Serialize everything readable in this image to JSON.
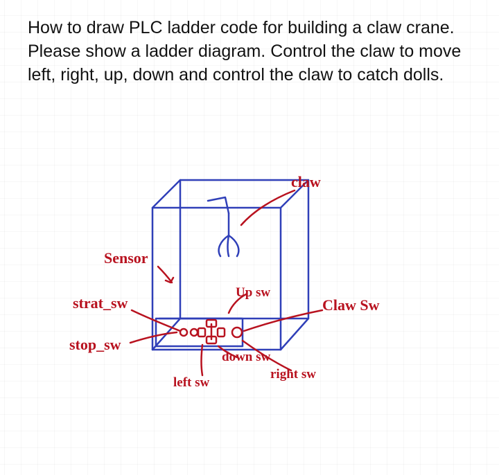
{
  "question": "How to draw PLC ladder code for building a claw crane. Please show a ladder diagram. Control the claw to move left, right, up, down and control the claw to catch dolls.",
  "labels": {
    "claw": "claw",
    "sensor": "Sensor",
    "start_sw": "strat_sw",
    "stop_sw": "stop_sw",
    "up_sw": "Up sw",
    "down_sw": "down sw",
    "left_sw": "left sw",
    "right_sw": "right sw",
    "claw_sw": "Claw Sw"
  },
  "colors": {
    "ink_red": "#b8121f",
    "ink_blue": "#2f3fb8",
    "text": "#111111"
  }
}
